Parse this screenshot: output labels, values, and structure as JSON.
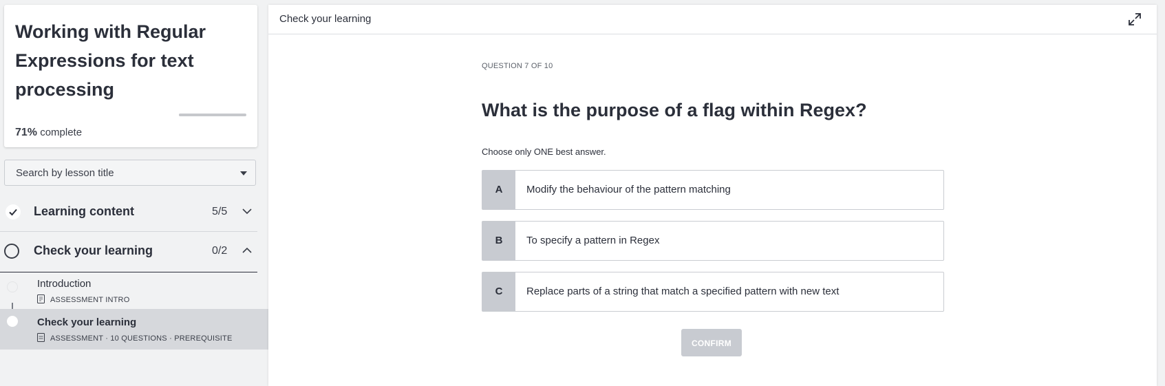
{
  "sidebar": {
    "course_title": "Working with Regular Expressions for text processing",
    "progress": {
      "percent": 71,
      "percent_label": "71%",
      "suffix": "complete"
    },
    "search": {
      "label": "Search by lesson title"
    },
    "sections": [
      {
        "title": "Learning content",
        "count": "5/5",
        "status": "complete",
        "expanded": false
      },
      {
        "title": "Check your learning",
        "count": "0/2",
        "status": "not-started",
        "expanded": true
      }
    ],
    "lessons": [
      {
        "title": "Introduction",
        "meta": "ASSESSMENT INTRO",
        "active": false
      },
      {
        "title": "Check your learning",
        "meta": "ASSESSMENT · 10 QUESTIONS · PREREQUISITE",
        "active": true
      }
    ]
  },
  "main": {
    "heading": "Check your learning",
    "question_number": "QUESTION 7 OF 10",
    "question": {
      "before": "What is the purpose of a ",
      "emphasis": "flag",
      "after": " within Regex?"
    },
    "instruction": "Choose only ONE best answer.",
    "options": [
      {
        "letter": "A",
        "text": "Modify the behaviour of the pattern matching"
      },
      {
        "letter": "B",
        "text": "To specify a pattern in Regex"
      },
      {
        "letter": "C",
        "text": "Replace parts of a string that match a specified pattern with new text"
      }
    ],
    "confirm_label": "CONFIRM"
  },
  "colors": {
    "text": "#2b2f3a",
    "option_letter_bg": "#c8cbd1",
    "disabled_button": "#c8cbd1",
    "active_lesson_bg": "#d6d8dc",
    "page_bg": "#f1f2f3"
  },
  "icons": {
    "complete": "check-icon",
    "not_started": "empty-circle-icon",
    "collapsed": "chevron-down-icon",
    "expanded": "chevron-up-icon",
    "lesson_intro": "document-icon",
    "lesson_assessment": "quiz-document-icon",
    "fullscreen": "expand-icon",
    "dropdown": "caret-down-icon"
  }
}
